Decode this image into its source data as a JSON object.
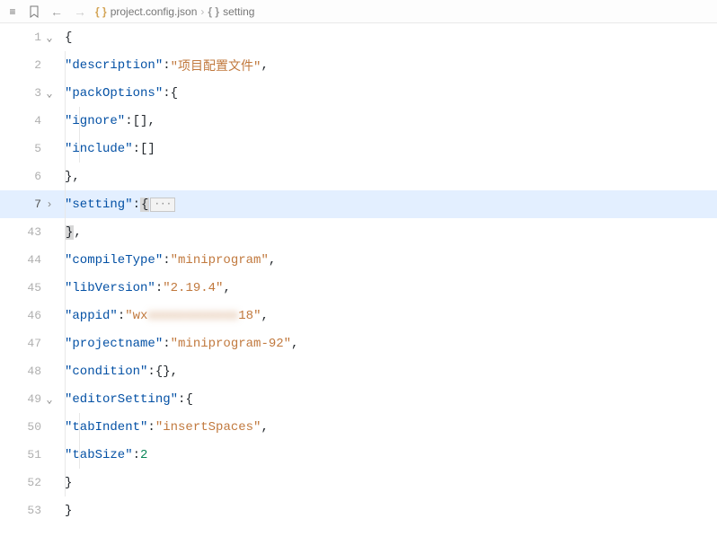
{
  "breadcrumb": {
    "file_icon": "{ }",
    "file": "project.config.json",
    "symbol_icon": "{ }",
    "symbol": "setting"
  },
  "lines": [
    {
      "num": "1",
      "fold": "down"
    },
    {
      "num": "2",
      "fold": ""
    },
    {
      "num": "3",
      "fold": "down"
    },
    {
      "num": "4",
      "fold": ""
    },
    {
      "num": "5",
      "fold": ""
    },
    {
      "num": "6",
      "fold": ""
    },
    {
      "num": "7",
      "fold": "right",
      "hl": true
    },
    {
      "num": "43",
      "fold": ""
    },
    {
      "num": "44",
      "fold": ""
    },
    {
      "num": "45",
      "fold": ""
    },
    {
      "num": "46",
      "fold": ""
    },
    {
      "num": "47",
      "fold": ""
    },
    {
      "num": "48",
      "fold": ""
    },
    {
      "num": "49",
      "fold": "down"
    },
    {
      "num": "50",
      "fold": ""
    },
    {
      "num": "51",
      "fold": ""
    },
    {
      "num": "52",
      "fold": ""
    },
    {
      "num": "53",
      "fold": ""
    }
  ],
  "code": {
    "l1_open": "{",
    "l2_key": "\"description\"",
    "l2_val": "\"项目配置文件\"",
    "l3_key": "\"packOptions\"",
    "l4_key": "\"ignore\"",
    "l5_key": "\"include\"",
    "l7_key": "\"setting\"",
    "l44_key": "\"compileType\"",
    "l44_val": "\"miniprogram\"",
    "l45_key": "\"libVersion\"",
    "l45_val": "\"2.19.4\"",
    "l46_key": "\"appid\"",
    "l46_val_prefix": "\"wx",
    "l46_val_blur": "xxxxxxxxxxxx",
    "l46_val_suffix": "18\"",
    "l47_key": "\"projectname\"",
    "l47_val": "\"miniprogram-92\"",
    "l48_key": "\"condition\"",
    "l49_key": "\"editorSetting\"",
    "l50_key": "\"tabIndent\"",
    "l50_val": "\"insertSpaces\"",
    "l51_key": "\"tabSize\"",
    "l51_val": "2",
    "folded_marker": "···"
  },
  "punc": {
    "colon": ":",
    "comma": ",",
    "open_brace": "{",
    "close_brace": "}",
    "open_bracket": "[",
    "close_bracket": "]",
    "empty_array": "[]",
    "empty_obj": "{}"
  }
}
